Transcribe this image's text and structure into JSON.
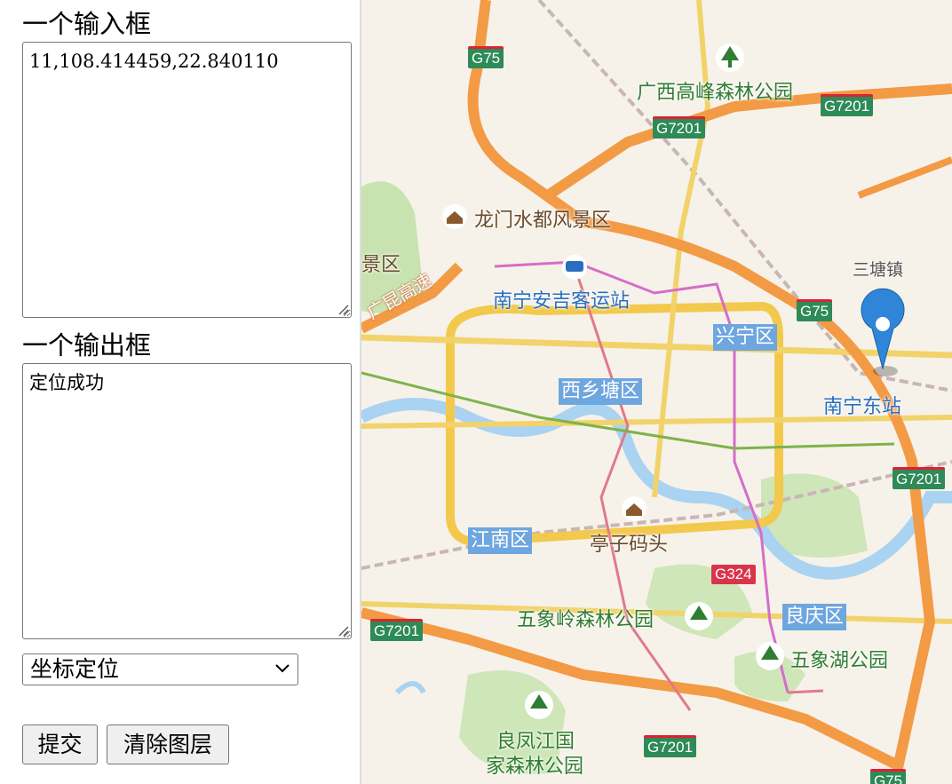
{
  "form": {
    "input_label": "一个输入框",
    "input_value": "11,108.414459,22.840110",
    "output_label": "一个输出框",
    "output_value": "定位成功",
    "select_value": "坐标定位",
    "submit_label": "提交",
    "clear_label": "清除图层"
  },
  "map": {
    "parks": [
      "广西高峰森林公园",
      "五象岭森林公园",
      "五象湖公园",
      "良凤江国",
      "家森林公园"
    ],
    "pois": [
      "龙门水都风景区",
      "亭子码头"
    ],
    "districts": [
      "兴宁区",
      "西乡塘区",
      "江南区",
      "良庆区"
    ],
    "stations": [
      "南宁安吉客运站",
      "南宁东站"
    ],
    "towns": [
      "三塘镇"
    ],
    "partial_labels": [
      "景区",
      "广昆高速"
    ],
    "highways": [
      "G75",
      "G7201",
      "G7201",
      "G75",
      "G7201",
      "G7201",
      "G7201",
      "G75"
    ],
    "national_roads": [
      "G324"
    ]
  },
  "colors": {
    "highway_orange": "#f39a45",
    "major_road_yellow": "#f2c94c",
    "river_blue": "#a9d3f0",
    "park_green": "#c8e3b0",
    "marker_blue": "#2f86d9",
    "district_blue": "#6ea6df"
  },
  "marker": {
    "icon": "map-pin-icon"
  }
}
